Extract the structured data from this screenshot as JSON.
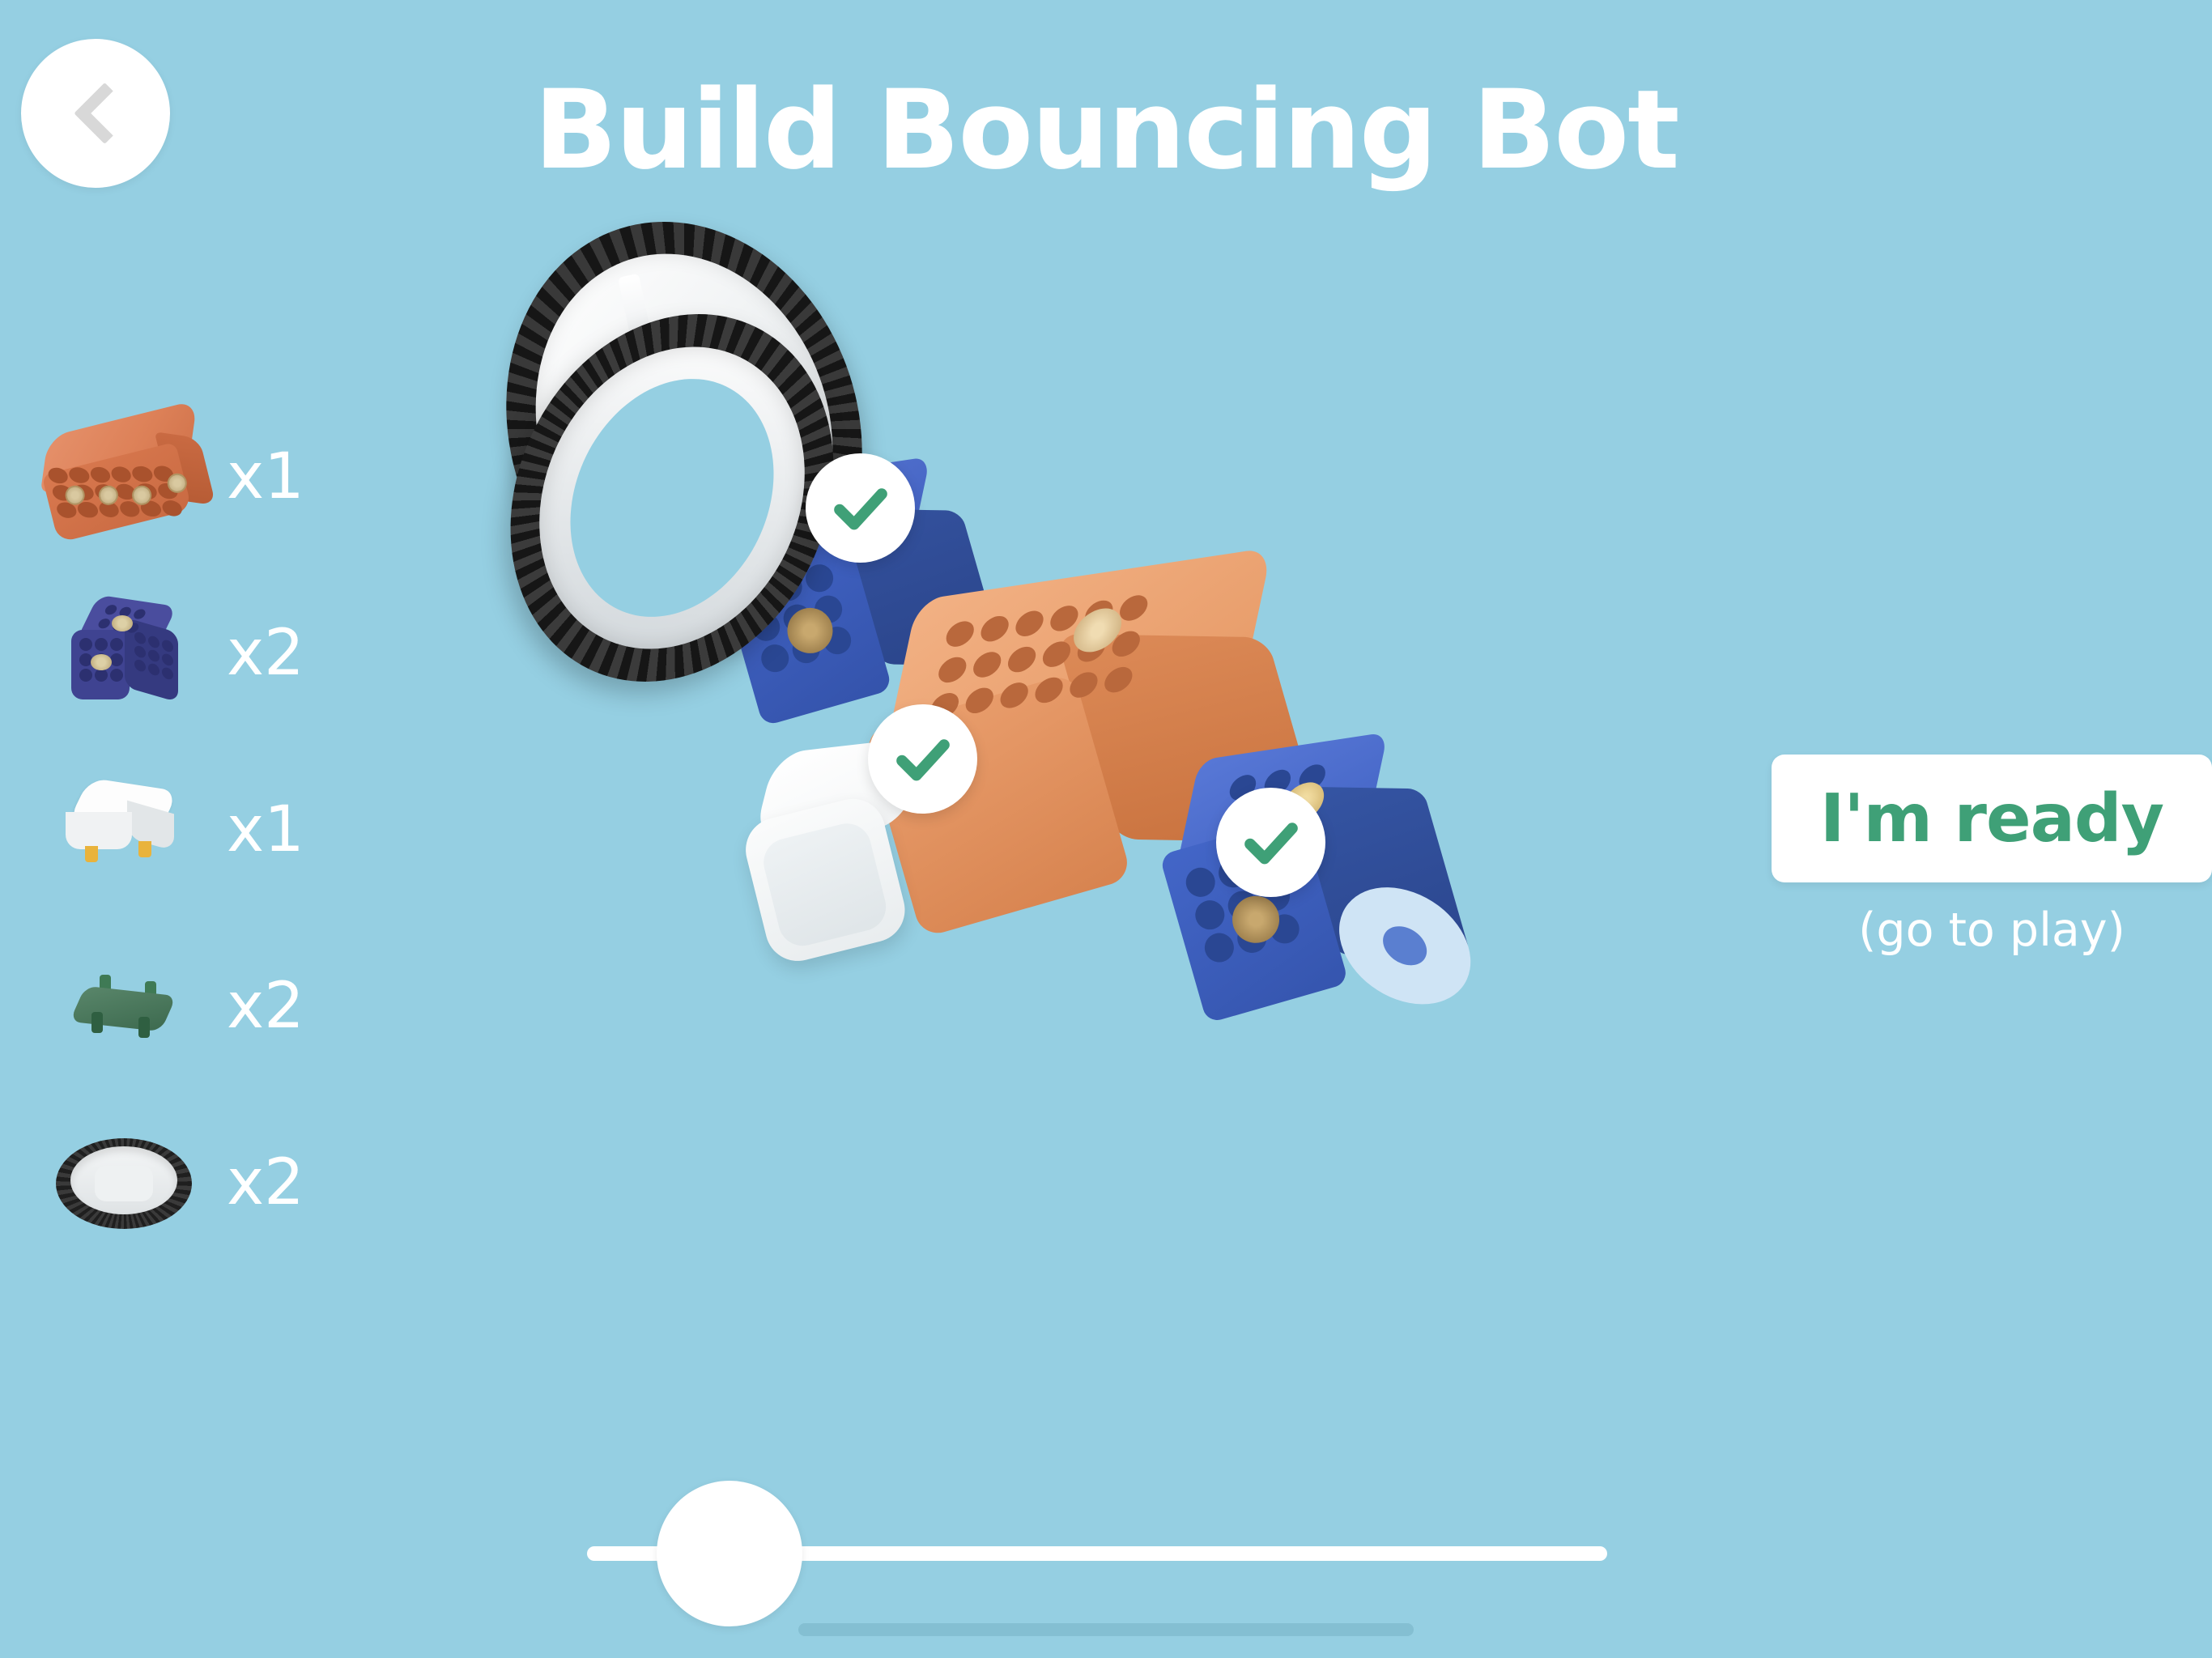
{
  "app": {
    "background_color": "#95cfe2",
    "accent_green": "#3fa077"
  },
  "header": {
    "title": "Build Bouncing Bot",
    "back_icon": "chevron-left-icon"
  },
  "parts_list": {
    "items": [
      {
        "name": "battery-brick",
        "color": "#d9794f",
        "quantity": "x1"
      },
      {
        "name": "blue-cube",
        "color": "#3f4391",
        "quantity": "x2"
      },
      {
        "name": "white-sensor",
        "color": "#fdfdfd",
        "quantity": "x1"
      },
      {
        "name": "green-connector",
        "color": "#3f7a55",
        "quantity": "x2"
      },
      {
        "name": "wheel",
        "color": "#1f1f1f",
        "quantity": "x2"
      }
    ]
  },
  "illustration": {
    "alt": "Exploded view of Bouncing Bot: two wheels, two blue cubes, orange battery brick, white sensor",
    "check_badges": [
      {
        "label": "check-badge-blue-cube-left",
        "icon": "check-icon",
        "color": "#3fa077"
      },
      {
        "label": "check-badge-orange-brick",
        "icon": "check-icon",
        "color": "#3fa077"
      },
      {
        "label": "check-badge-blue-cube-right",
        "icon": "check-icon",
        "color": "#3fa077"
      }
    ]
  },
  "ready": {
    "label": "I'm ready",
    "sub_label": "(go to play)"
  },
  "progress": {
    "value_percent": 14,
    "thumb_label": "build-step-slider"
  }
}
